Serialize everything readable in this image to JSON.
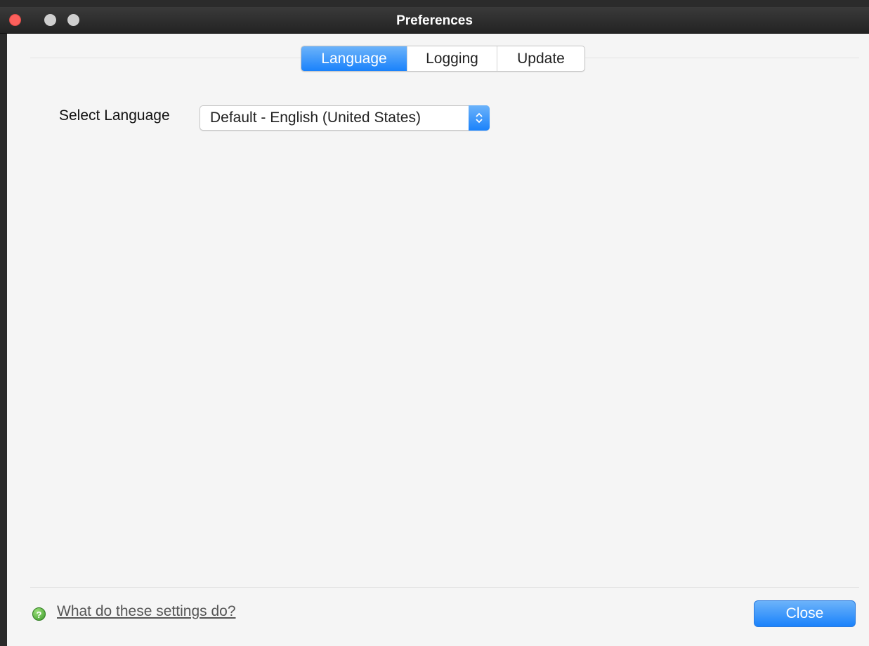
{
  "window": {
    "title": "Preferences"
  },
  "tabs": [
    {
      "label": "Language",
      "active": true
    },
    {
      "label": "Logging",
      "active": false
    },
    {
      "label": "Update",
      "active": false
    }
  ],
  "language": {
    "label": "Select Language",
    "selected": "Default - English (United States)"
  },
  "footer": {
    "help_link": "What do these settings do?",
    "help_icon": "?",
    "close_label": "Close"
  },
  "colors": {
    "accent": "#1a82fb",
    "close_light": "#fc605c"
  }
}
